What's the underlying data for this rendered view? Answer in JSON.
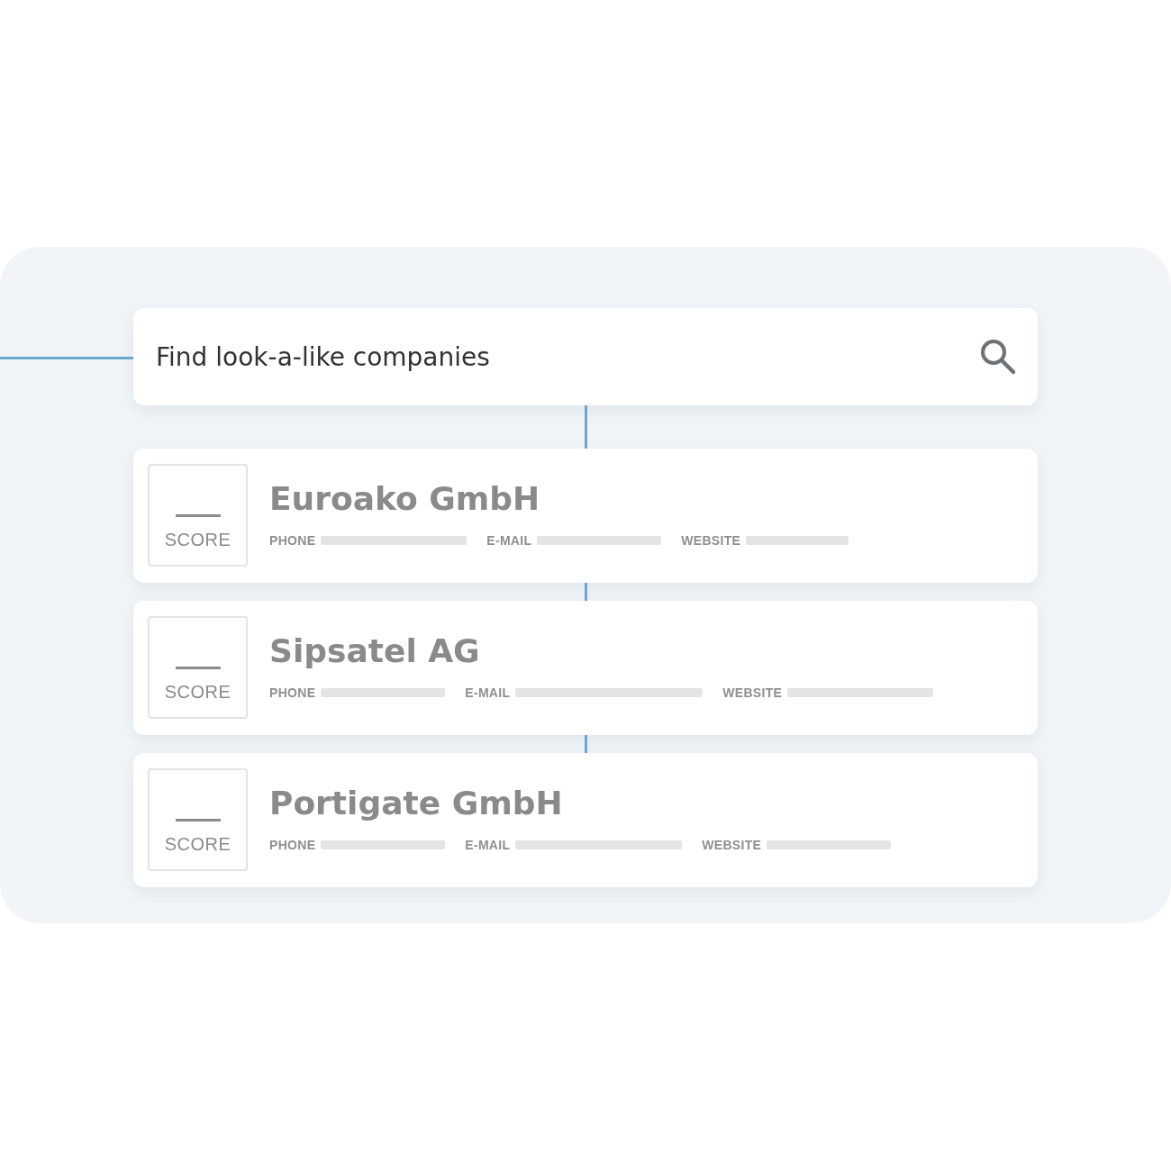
{
  "search": {
    "query": "Find look-a-like companies"
  },
  "companies": [
    {
      "name": "Euroako GmbH",
      "score_label": "SCORE",
      "fields": [
        {
          "label": "PHONE"
        },
        {
          "label": "E-MAIL"
        },
        {
          "label": "WEBSITE"
        }
      ]
    },
    {
      "name": "Sipsatel AG",
      "score_label": "SCORE",
      "fields": [
        {
          "label": "PHONE"
        },
        {
          "label": "E-MAIL"
        },
        {
          "label": "WEBSITE"
        }
      ]
    },
    {
      "name": "Portigate GmbH",
      "score_label": "SCORE",
      "fields": [
        {
          "label": "PHONE"
        },
        {
          "label": "E-MAIL"
        },
        {
          "label": "WEBSITE"
        }
      ]
    }
  ]
}
